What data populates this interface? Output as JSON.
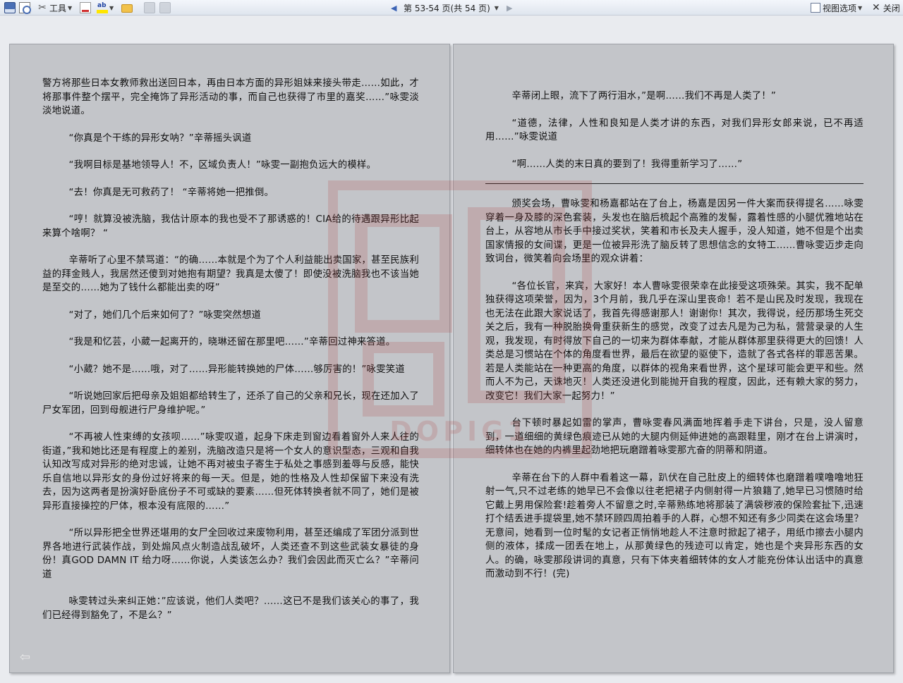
{
  "toolbar": {
    "tools_label": "工具",
    "page_status": "第 53-54 页(共 54 页)",
    "view_options_label": "视图选项",
    "close_label": "关闭",
    "highlight_glyph": "ab"
  },
  "watermark": {
    "text": "DOPIG1"
  },
  "left_page": {
    "paragraphs": [
      {
        "text": "警方将那些日本女教师救出送回日本，再由日本方面的异形姐妹来接头带走……如此，才将那事件整个摆平，完全掩饰了异形活动的事，而自己也获得了市里的嘉奖……”咏雯淡淡地说道。",
        "indent": false
      },
      {
        "text": "“你真是个干练的异形女呐？”辛蒂摇头讽道",
        "indent": true
      },
      {
        "text": "“我啊目标是基地领导人！不，区域负责人！”咏雯一副抱负远大的模样。",
        "indent": true
      },
      {
        "text": "“去！你真是无可救药了！ “辛蒂将她一把推倒。",
        "indent": true
      },
      {
        "text": "“哼！就算没被洗脑，我估计原本的我也受不了那诱惑的！CIA给的待遇跟异形比起来算个啥啊？ “",
        "indent": true
      },
      {
        "text": "辛蒂听了心里不禁骂道：“的确……本就是个为了个人利益能出卖国家，甚至民族利益的拜金贱人，我居然还傻到对她抱有期望？我真是太傻了！即使没被洗脑我也不该当她是至交的……她为了钱什么都能出卖的呀”",
        "indent": true
      },
      {
        "text": "“对了，她们几个后来如何了？”咏雯突然想道",
        "indent": true
      },
      {
        "text": "“我是和忆芸，小葳一起离开的，晓琳还留在那里吧……”辛蒂回过神来答道。",
        "indent": true
      },
      {
        "text": "“小葳？她不是……哦，对了……异形能转换她的尸体……够厉害的！”咏雯笑道",
        "indent": true
      },
      {
        "text": "“听说她回家后把母亲及姐姐都给转生了，还杀了自己的父亲和兄长，现在还加入了尸女军团，回到母舰进行尸身维护呢。”",
        "indent": true
      },
      {
        "text": "“不再被人性束缚的女孩呗……”咏雯叹道，起身下床走到窗边看着窗外人来人往的街道，”我和她比还是有程度上的差别，洗脑改造只是将一个女人的意识型态，三观和自我认知改写成对异形的绝对忠诚，让她不再对被虫子寄生于私处之事感到羞辱与反感，能快乐自信地以异形女的身份过好将来的每一天。但是，她的性格及人性却保留下来没有洗去，因为这两者是扮演好卧底份子不可或缺的要素……但死体转换者就不同了，她们是被异形直接操控的尸体，根本没有底限的……”",
        "indent": true
      },
      {
        "text": "“所以异形把全世界还堪用的女尸全回收过来废物利用，甚至还编成了军团分派到世界各地进行武装作战，到处煽风点火制造战乱破坏，人类还查不到这些武装女暴徒的身份！真GOD DAMN IT 给力呀……你说，人类该怎么办？我们会因此而灭亡么？”辛蒂问道",
        "indent": true
      },
      {
        "text": "咏雯转过头来纠正她：”应该说，他们人类吧？……这已不是我们该关心的事了，我们已经得到豁免了，不是么？”",
        "indent": true
      }
    ]
  },
  "right_page": {
    "paragraphs_top": [
      {
        "text": "辛蒂闭上眼，流下了两行泪水，”是啊……我们不再是人类了！”",
        "indent": true
      },
      {
        "text": "“道德，法律，人性和良知是人类才讲的东西，对我们异形女郎来说，已不再适用……”咏雯说道",
        "indent": true
      },
      {
        "text": "“啊……人类的末日真的要到了！我得重新学习了……”",
        "indent": true
      }
    ],
    "paragraphs_bottom": [
      {
        "text": "颁奖会场，曹咏雯和杨嘉都站在了台上，杨嘉是因另一件大案而获得提名……咏雯穿着一身及膝的深色套装，头发也在脑后梳起个高雅的发髻，露着性感的小腿优雅地站在台上，从容地从市长手中接过奖状，笑着和市长及夫人握手，没人知道，她不但是个出卖国家情报的女间谍，更是一位被异形洗了脑反转了思想信念的女特工……曹咏雯迈步走向致词台，微笑着向会场里的观众讲着：",
        "indent": true
      },
      {
        "text": "“各位长官，来宾，大家好！本人曹咏雯很荣幸在此接受这项殊荣。其实，我不配单独获得这项荣誉，因为，3个月前，我几乎在深山里丧命！若不是山民及时发现，我现在也无法在此跟大家说话了，我首先得感谢那人！谢谢你！其次，我得说，经历那场生死交关之后，我有一种脱胎换骨重获新生的感觉，改变了过去凡是为己为私，营营录录的人生观，我发现，有时得放下自己的一切来为群体奉献，才能从群体那里获得更大的回馈！人类总是习惯站在个体的角度看世界，最后在欲望的驱使下，造就了各式各样的罪恶苦果。若是人类能站在一种更高的角度，以群体的视角来看世界，这个星球可能会更平和些。然而人不为己，天诛地灭！人类还没进化到能抛开自我的程度，因此，还有赖大家的努力，改变它！我们大家一起努力！”",
        "indent": true
      },
      {
        "text": "台下顿时暴起如雷的掌声，曹咏雯春风满面地挥着手走下讲台，只是，没人留意到，一道细细的黄绿色痕迹已从她的大腿内侧延伸进她的高跟鞋里，刚才在台上讲演时，细转体也在她的内裤里起劲地把玩磨蹭着咏雯那亢奋的阴蒂和阴道。",
        "indent": true
      },
      {
        "text": "辛蒂在台下的人群中看着这一幕，趴伏在自己肚皮上的细转体也磨蹭着噗噜噜地狂射一气,只不过老练的她早已不会像以往老把裙子内侧射得一片狼籍了,她早已习惯随时给它戴上男用保险套!趁着旁人不留意之时,辛蒂熟练地将那装了满袋秽液的保险套扯下,迅速打个结丢进手提袋里,她不禁环顾四周拍着手的人群，心想不知还有多少同类在这会场里？无意间，她看到一位时髦的女记者正悄悄地趁人不注意时掀起了裙子，用纸巾擦去小腿内侧的液体，揉成一团丢在地上，从那黄绿色的残迹可以肯定，她也是个夹异形东西的女人。的确，咏雯那段讲词的真意，只有下体夹着细转体的女人才能充份体认出话中的真意而激动到不行！(完)",
        "indent": true
      }
    ]
  }
}
